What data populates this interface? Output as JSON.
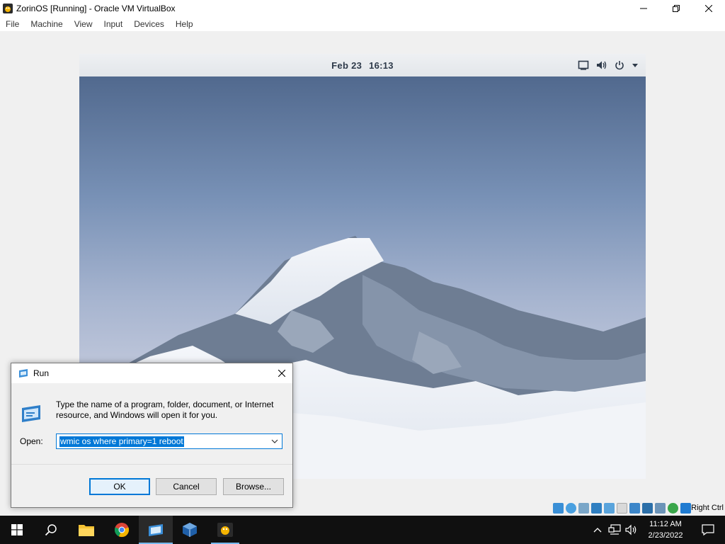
{
  "window": {
    "title": "ZorinOS [Running] - Oracle VM VirtualBox",
    "icon": "virtualbox-app-icon",
    "controls": [
      "minimize-icon",
      "restore-icon",
      "close-icon"
    ]
  },
  "menu": {
    "items": [
      "File",
      "Machine",
      "View",
      "Input",
      "Devices",
      "Help"
    ]
  },
  "guest": {
    "date": "Feb 23",
    "time": "16:13",
    "tray_icons": [
      "screen-icon",
      "volume-icon",
      "power-icon",
      "chevron-down-icon"
    ]
  },
  "statusbar": {
    "icons": [
      "hard-disk-icon",
      "optical-disk-icon",
      "audio-icon",
      "network-icon",
      "usb-icon",
      "shared-folders-icon",
      "display-icon",
      "recording-icon",
      "cpu-icon",
      "mouse-integration-icon",
      "keyboard-icon"
    ],
    "host_key": "Right Ctrl"
  },
  "run_dialog": {
    "title": "Run",
    "description": "Type the name of a program, folder, document, or Internet resource, and Windows will open it for you.",
    "open_label": "Open:",
    "open_value": "wmic os where primary=1 reboot",
    "ok_label": "OK",
    "cancel_label": "Cancel",
    "browse_label": "Browse..."
  },
  "taskbar": {
    "apps": [
      "start-icon",
      "search-icon",
      "file-explorer-icon",
      "chrome-icon",
      "run-icon",
      "virtualbox-icon",
      "zorin-vm-icon"
    ],
    "tray": [
      "chevron-up-icon",
      "network-icon",
      "speaker-icon"
    ],
    "clock_time": "11:12 AM",
    "clock_date": "2/23/2022"
  },
  "colors": {
    "accent": "#0078d7",
    "taskbar": "#101010",
    "guest_bar": "#e8eaee"
  }
}
